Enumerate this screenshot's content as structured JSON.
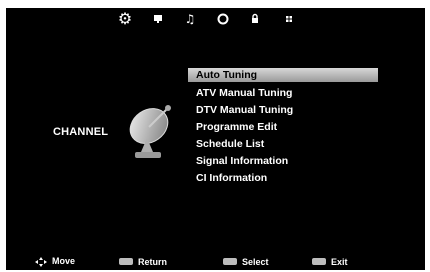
{
  "top_icons": [
    {
      "name": "settings-gear-icon",
      "glyph": "⚙"
    },
    {
      "name": "picture-icon",
      "glyph": "▭"
    },
    {
      "name": "sound-icon",
      "glyph": "♫"
    },
    {
      "name": "time-icon",
      "glyph": "◔"
    },
    {
      "name": "lock-icon",
      "glyph": "🔒"
    },
    {
      "name": "setup-icon",
      "glyph": "▦"
    }
  ],
  "section": {
    "label": "CHANNEL"
  },
  "menu": {
    "items": [
      {
        "label": "Auto Tuning",
        "selected": true
      },
      {
        "label": "ATV Manual Tuning"
      },
      {
        "label": "DTV Manual Tuning"
      },
      {
        "label": "Programme Edit"
      },
      {
        "label": "Schedule List"
      },
      {
        "label": "Signal Information"
      },
      {
        "label": "CI  Information"
      }
    ]
  },
  "footer": {
    "move": "Move",
    "return": "Return",
    "select": "Select",
    "exit": "Exit"
  },
  "colors": {
    "background": "#000000",
    "highlight_top": "#d8d8d8",
    "highlight_bottom": "#9a9a9a",
    "text": "#ffffff"
  }
}
